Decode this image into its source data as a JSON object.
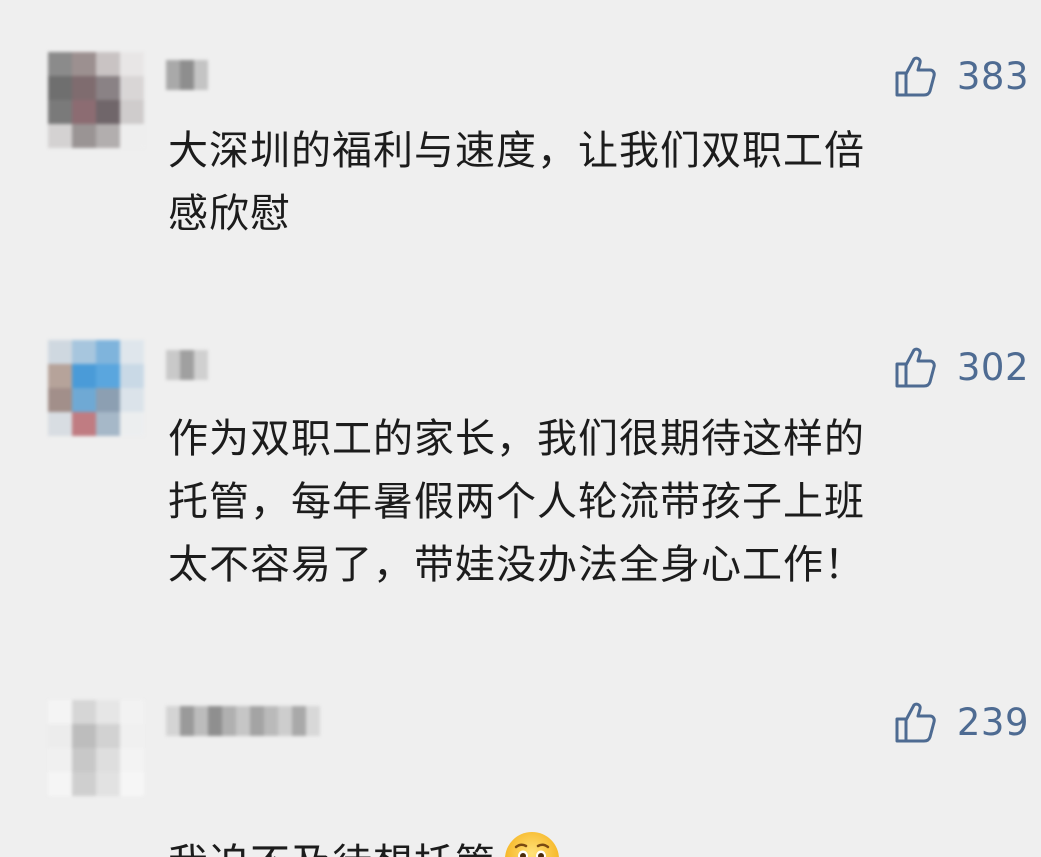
{
  "comments": [
    {
      "text": "大深圳的福利与速度，让我们双职工倍\n感欣慰",
      "likes": "383",
      "avatar": "blurred-avatar",
      "nickname": "blurred-nickname"
    },
    {
      "text": "作为双职工的家长，我们很期待这样的\n托管，每年暑假两个人轮流带孩子上班\n太不容易了，带娃没办法全身心工作！",
      "likes": "302",
      "avatar": "blurred-avatar",
      "nickname": "blurred-nickname"
    },
    {
      "text": "我迫不及待想托管",
      "likes": "239",
      "avatar": "blurred-avatar",
      "nickname": "blurred-nickname",
      "emoji": "crying-face-emoji"
    }
  ],
  "colors": {
    "background": "#efefef",
    "text": "#1c1c1c",
    "like": "#4e6b92"
  },
  "icons": {
    "like": "thumbs-up-icon"
  }
}
